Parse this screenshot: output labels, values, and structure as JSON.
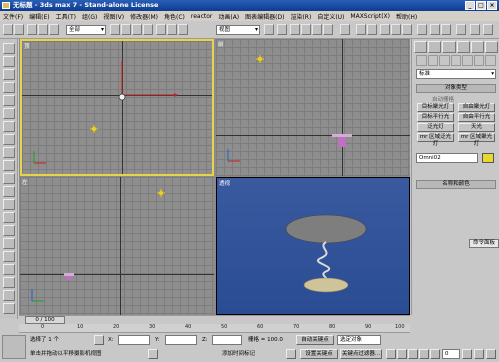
{
  "window": {
    "title": "无标题 - 3ds max 7 - Stand-alone License",
    "min": "_",
    "max": "□",
    "close": "×"
  },
  "menu": [
    "文件(F)",
    "编辑(E)",
    "工具(T)",
    "组(G)",
    "视图(V)",
    "修改器(M)",
    "角色(C)",
    "reactor",
    "动画(A)",
    "图表编辑器(D)",
    "渲染(R)",
    "自定义(U)",
    "MAXScript(X)",
    "帮助(H)"
  ],
  "toolbar": {
    "selection_filter": "全部",
    "ref_coord": "视图"
  },
  "viewports": {
    "top": "顶",
    "front": "前",
    "left": "左",
    "perspective": "透视"
  },
  "command_panel": {
    "category": "标准",
    "rollout_object_type": "对象类型",
    "autogrid": "自动栅格",
    "lights": [
      "目标聚光灯",
      "自由聚光灯",
      "目标平行光",
      "自由平行光",
      "泛光灯",
      "天光",
      "mr 区域泛光灯",
      "mr 区域聚光灯"
    ],
    "rollout_name_color": "名称和颜色",
    "object_name": "Omni02",
    "swatch_color": "#e8d830"
  },
  "grid_window_label": "命令面板",
  "time_slider": {
    "frame_display": "0 / 100"
  },
  "ruler_ticks": [
    "0",
    "10",
    "20",
    "30",
    "40",
    "50",
    "60",
    "70",
    "80",
    "90",
    "100"
  ],
  "status": {
    "selected_count": "选择了 1 个",
    "x_label": "X:",
    "y_label": "Y:",
    "z_label": "Z:",
    "grid_readout": "栅格 = 100.0",
    "auto_key": "自动关键点",
    "key_filter_select": "选定对象",
    "prompt": "单击并拖动以平移摄影机视图",
    "add_time_tag": "添加时间标记",
    "set_key": "设置关键点",
    "key_filters": "关键点过滤器...",
    "frame_field": "0"
  }
}
